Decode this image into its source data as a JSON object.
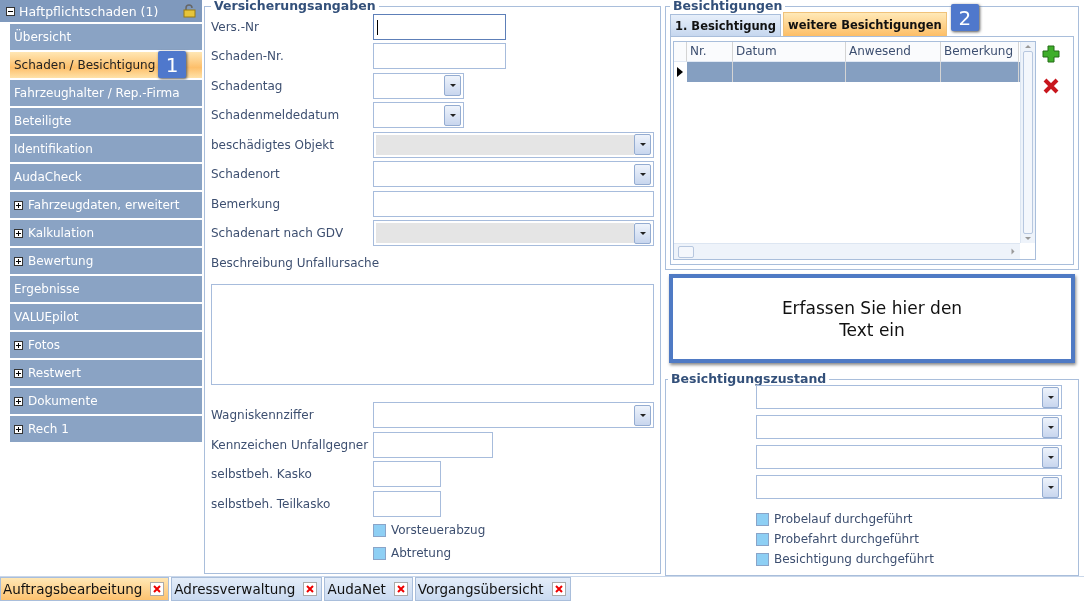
{
  "sidebar": {
    "header": {
      "label": "Haftpflichtschaden (1)",
      "expanded": true
    },
    "items": [
      {
        "label": "Übersicht",
        "selected": false
      },
      {
        "label": "Schaden / Besichtigung",
        "selected": true,
        "badge": "1"
      },
      {
        "label": "Fahrzeughalter / Rep.-Firma",
        "selected": false
      },
      {
        "label": "Beteiligte",
        "selected": false
      },
      {
        "label": "Identifikation",
        "selected": false
      },
      {
        "label": "AudaCheck",
        "selected": false
      },
      {
        "label": "Fahrzeugdaten, erweitert",
        "selected": false,
        "expanded": false
      },
      {
        "label": "Kalkulation",
        "selected": false,
        "expanded": false
      },
      {
        "label": "Bewertung",
        "selected": false,
        "expanded": false
      },
      {
        "label": "Ergebnisse",
        "selected": false
      },
      {
        "label": "VALUEpilot",
        "selected": false
      },
      {
        "label": "Fotos",
        "selected": false,
        "expanded": false
      },
      {
        "label": "Restwert",
        "selected": false,
        "expanded": false
      },
      {
        "label": "Dokumente",
        "selected": false,
        "expanded": false
      },
      {
        "label": "Rech 1",
        "selected": false,
        "expanded": false
      }
    ]
  },
  "insurance": {
    "title": "Versicherungsangaben",
    "fields": [
      {
        "label": "Vers.-Nr",
        "kind": "text",
        "focused": true
      },
      {
        "label": "Schaden-Nr.",
        "kind": "text",
        "focused": false
      },
      {
        "label": "Schadentag",
        "kind": "date",
        "focused": false
      },
      {
        "label": "Schadenmeldedatum",
        "kind": "date",
        "focused": false
      },
      {
        "label": "beschädigtes Objekt",
        "kind": "select",
        "disabled": true
      },
      {
        "label": "Schadenort",
        "kind": "select",
        "disabled": false
      },
      {
        "label": "Bemerkung",
        "kind": "wide",
        "focused": false
      },
      {
        "label": "Schadenart nach GDV",
        "kind": "select",
        "disabled": true
      },
      {
        "label": "Beschreibung Unfallursache",
        "kind": "textarea"
      },
      {
        "label": "Wagniskennziffer",
        "kind": "select",
        "disabled": false
      },
      {
        "label": "Kennzeichen Unfallgegner",
        "kind": "medium",
        "focused": false
      },
      {
        "label": "selbstbeh. Kasko",
        "kind": "small",
        "focused": false
      },
      {
        "label": "selbstbeh. Teilkasko",
        "kind": "small",
        "focused": false
      }
    ],
    "checkboxes": [
      {
        "label": "Vorsteuerabzug",
        "checked": false
      },
      {
        "label": "Abtretung",
        "checked": false
      }
    ]
  },
  "inspections": {
    "title": "Besichtigungen",
    "tabs": [
      {
        "label": "1. Besichtigung",
        "selected": false
      },
      {
        "label": "weitere Besichtigungen",
        "selected": true,
        "badge": "2"
      }
    ],
    "grid": {
      "columns": [
        "Nr.",
        "Datum",
        "Anwesend",
        "Bemerkung"
      ],
      "rows": [
        {
          "selected": true
        }
      ]
    },
    "note": "Erfassen Sie hier den Text ein"
  },
  "condition": {
    "title": "Besichtigungszustand",
    "selects": [
      {
        "disabled": false
      },
      {
        "disabled": false
      },
      {
        "disabled": false
      },
      {
        "disabled": false
      }
    ],
    "checkboxes": [
      {
        "label": "Probelauf durchgeführt",
        "checked": false
      },
      {
        "label": "Probefahrt durchgeführt",
        "checked": false
      },
      {
        "label": "Besichtigung durchgeführt",
        "checked": false
      }
    ]
  },
  "bottom_tabs": [
    {
      "label": "Auftragsbearbeitung",
      "selected": true
    },
    {
      "label": "Adressverwaltung",
      "selected": false
    },
    {
      "label": "AudaNet",
      "selected": false
    },
    {
      "label": "Vorgangsübersicht",
      "selected": false
    }
  ]
}
